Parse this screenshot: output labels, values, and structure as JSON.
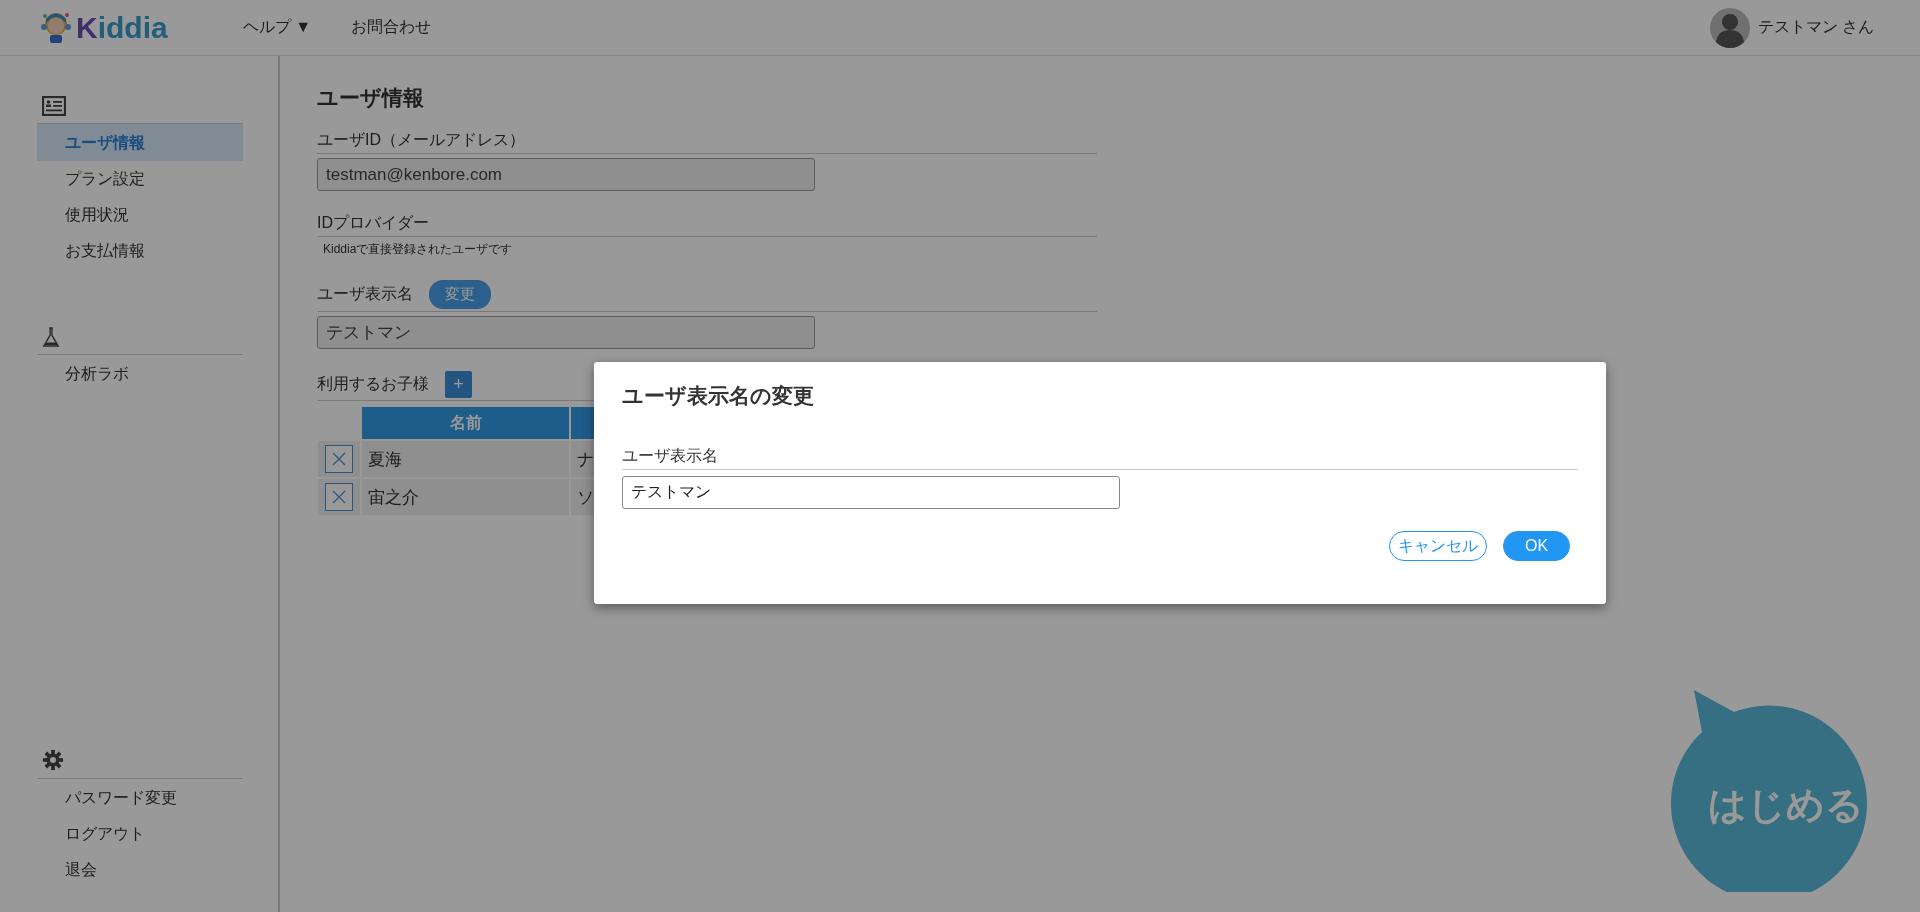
{
  "header": {
    "logo_text": "Kiddia",
    "nav": [
      {
        "label": "ヘルプ",
        "caret": "▼"
      },
      {
        "label": "お問合わせ"
      }
    ],
    "user_name": "テストマン さん"
  },
  "sidebar": {
    "sections": [
      {
        "kind": "card",
        "items": [
          {
            "label": "ユーザ情報",
            "selected": true
          },
          {
            "label": "プラン設定",
            "selected": false
          },
          {
            "label": "使用状況",
            "selected": false
          },
          {
            "label": "お支払情報",
            "selected": false
          }
        ]
      },
      {
        "kind": "flask",
        "items": [
          {
            "label": "分析ラボ",
            "selected": false
          }
        ]
      },
      {
        "kind": "gear",
        "items": [
          {
            "label": "パスワード変更",
            "selected": false
          },
          {
            "label": "ログアウト",
            "selected": false
          },
          {
            "label": "退会",
            "selected": false
          }
        ]
      }
    ]
  },
  "main": {
    "title": "ユーザ情報",
    "fields": [
      {
        "kind": "input",
        "label": "ユーザID（メールアドレス）",
        "value": "testman@kenbore.com"
      },
      {
        "kind": "note",
        "label": "IDプロバイダー",
        "note": "Kiddiaで直接登録されたユーザです"
      },
      {
        "kind": "input",
        "label": "ユーザ表示名",
        "button": "変更",
        "value": "テストマン"
      }
    ],
    "children": {
      "label": "利用するお子様",
      "add_button": "+",
      "columns": [
        "名前",
        ""
      ],
      "rows": [
        {
          "name": "夏海",
          "column_2": "ナ"
        },
        {
          "name": "宙之介",
          "column_2": "ソ"
        }
      ]
    }
  },
  "dialog": {
    "title": "ユーザ表示名の変更",
    "label": "ユーザ表示名",
    "value": "テストマン",
    "buttons": [
      {
        "label": "キャンセル",
        "kind": "secondary"
      },
      {
        "label": "OK",
        "kind": "primary"
      }
    ]
  },
  "start_button": "はじめる"
}
